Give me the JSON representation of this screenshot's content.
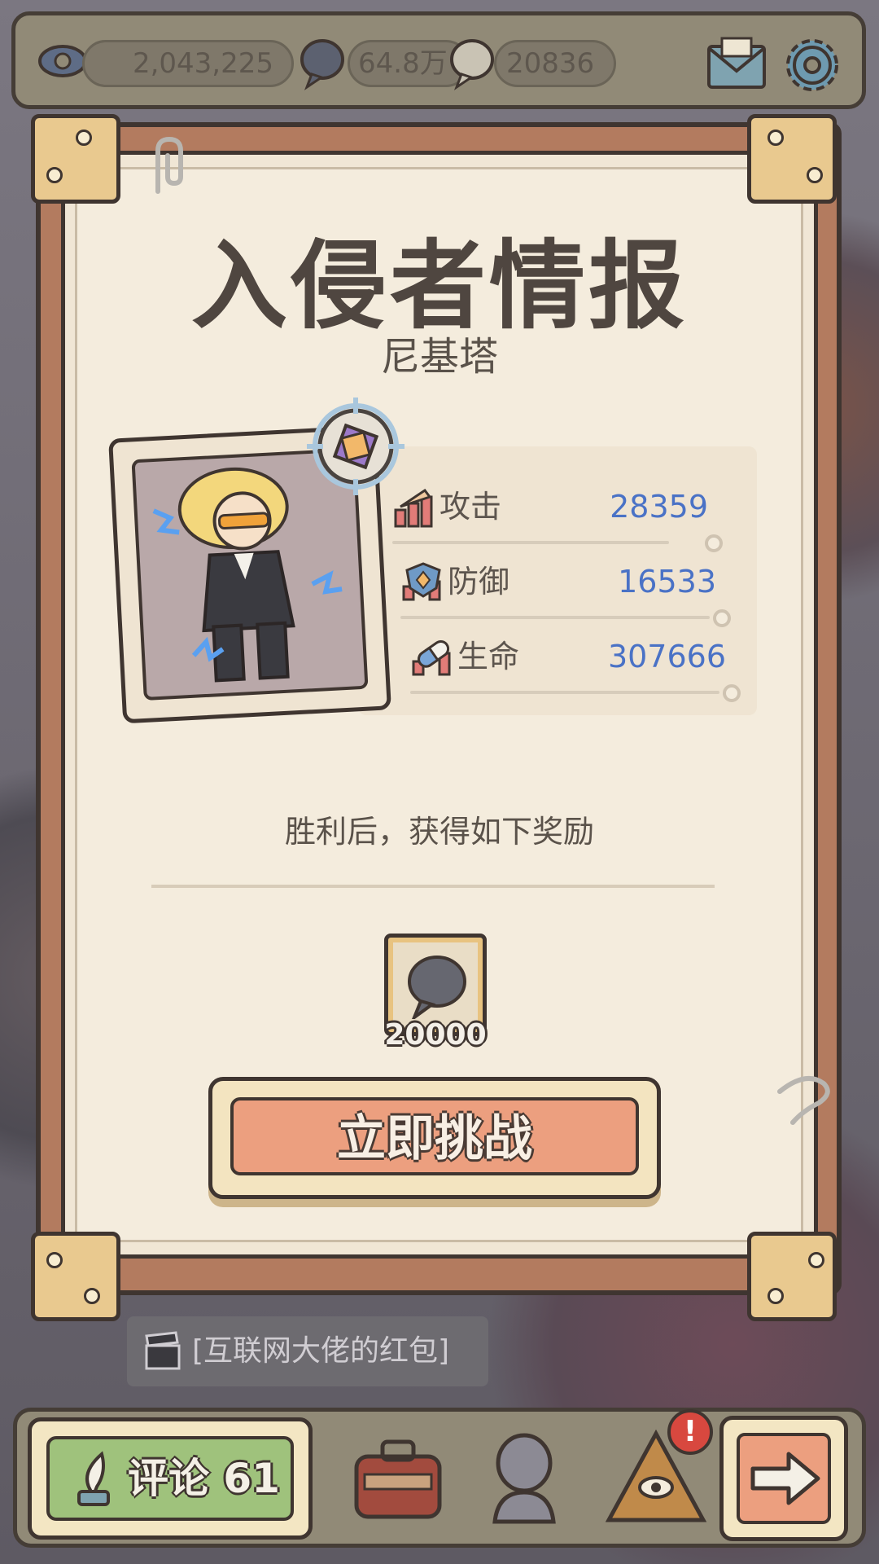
{
  "top_bar": {
    "views": "2,043,225",
    "dark_bubbles": "64.8万",
    "light_bubbles": "20836",
    "icons": [
      "eye-icon",
      "dark-bubble-icon",
      "light-bubble-icon",
      "mail-icon",
      "gear-icon"
    ]
  },
  "panel": {
    "title": "入侵者情报",
    "subtitle": "尼基塔",
    "stats": [
      {
        "icon": "attack-icon",
        "label": "攻击",
        "value": "28359"
      },
      {
        "icon": "defense-icon",
        "label": "防御",
        "value": "16533"
      },
      {
        "icon": "health-icon",
        "label": "生命",
        "value": "307666"
      }
    ],
    "reward_text": "胜利后，获得如下奖励",
    "reward": {
      "icon": "dark-bubble-icon",
      "count": "20000"
    },
    "challenge_label": "立即挑战"
  },
  "toast": {
    "text": "[互联网大佬的红包]",
    "icon": "clapperboard-icon"
  },
  "bottom_bar": {
    "comment_label": "评论 61",
    "badge": "!",
    "icons": [
      "quill-icon",
      "suitcase-icon",
      "bust-icon",
      "pyramid-eye-icon",
      "arrow-right-icon"
    ]
  },
  "colors": {
    "accent_blue": "#4a72c6",
    "button_orange": "#ec9f7f",
    "button_green": "#9fc27c",
    "paper": "#f4ecdd"
  }
}
